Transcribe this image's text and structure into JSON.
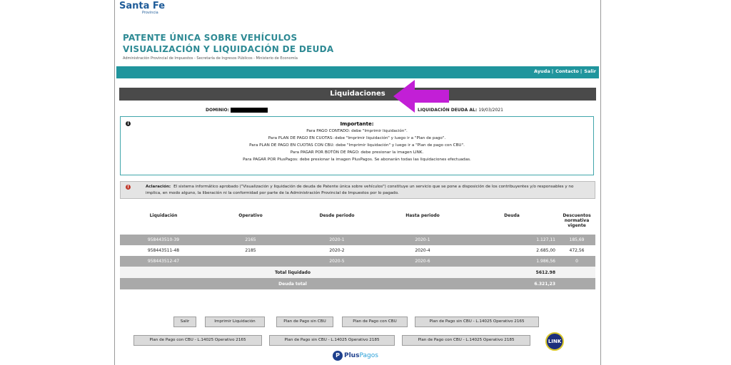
{
  "header": {
    "logo_text": "Santa Fe",
    "logo_sub": "Provincia",
    "title_line1": "PATENTE ÚNICA SOBRE VEHÍCULOS",
    "title_line2": "VISUALIZACIÓN Y LIQUIDACIÓN DE DEUDA",
    "subtitle": "Administración Provincial de Impuestos - Secretaría de Ingresos Públicos - Ministerio de Economía",
    "links": [
      "Ayuda",
      "Contacto",
      "Salir"
    ]
  },
  "section_title": "Liquidaciones",
  "dominio_label": "DOMINIO:",
  "liquidacion_label": "LIQUIDACIÓN DEUDA AL:",
  "liquidacion_date": "19/03/2021",
  "importante": {
    "title": "Importante:",
    "lines": [
      "Para PAGO CONTADO: debe \"Imprimir liquidación\".",
      "Para PLAN DE PAGO EN CUOTAS: debe \"Imprimir liquidación\" y luego ir a \"Plan de pago\".",
      "Para PLAN DE PAGO EN CUOTAS CON CBU: debe \"Imprimir liquidación\" y luego ir a \"Plan de pago con CBU\".",
      "Para PAGAR POR BOTÓN DE PAGO: debe presionar la imagen LINK.",
      "Para PAGAR POR PlusPagos: debe presionar la imagen PlusPagos. Se abonarán todas las liquidaciones efectuadas."
    ]
  },
  "aclaracion": {
    "label": "Aclaración:",
    "text": "El sistema informático aprobado (\"Visualización y liquidación de deuda de Patente única sobre vehículos\") constituye un servicio que se pone a disposición de los contribuyentes y/o responsables y no implica, en modo alguno, la liberación ni la conformidad por parte de la Administración Provincial de Impuestos por lo pagado."
  },
  "table": {
    "headers": [
      "Liquidación",
      "Operativo",
      "Desde periodo",
      "Hasta periodo",
      "Deuda",
      "Descuentos normativa vigente"
    ],
    "rows": [
      [
        "958443510-39",
        "2165",
        "2020-1",
        "2020-1",
        "1.127,11",
        "185,69"
      ],
      [
        "958443511-48",
        "2185",
        "2020-2",
        "2020-4",
        "2.685,00",
        "472,56"
      ],
      [
        "958443512-47",
        "",
        "2020-5",
        "2020-6",
        "1.986,56",
        "0"
      ]
    ],
    "total_liquidado_label": "Total liquidado",
    "total_liquidado": "5612.98",
    "deuda_total_label": "Deuda total",
    "deuda_total": "6.321,23"
  },
  "buttons": {
    "salir": "Salir",
    "imprimir": "Imprimir Liquidación",
    "plan_sin_cbu": "Plan de Pago sin CBU",
    "plan_con_cbu": "Plan de Pago con CBU",
    "plan_sin_cbu_2165": "Plan de Pago sin CBU - L.14025 Operativo 2165",
    "plan_con_cbu_2165": "Plan de Pago con CBU - L.14025 Operativo 2165",
    "plan_sin_cbu_2185": "Plan de Pago sin CBU - L.14025 Operativo 2185",
    "plan_con_cbu_2185": "Plan de Pago con CBU - L.14025 Operativo 2185"
  },
  "link_logo": "LINK",
  "pluspagos": {
    "part1": "Plus",
    "part2": "Pagos"
  },
  "colors": {
    "teal": "#20959d",
    "dark_bar": "#4a4a4a",
    "arrow": "#c21fd6",
    "row_gray": "#a9a9a9"
  }
}
